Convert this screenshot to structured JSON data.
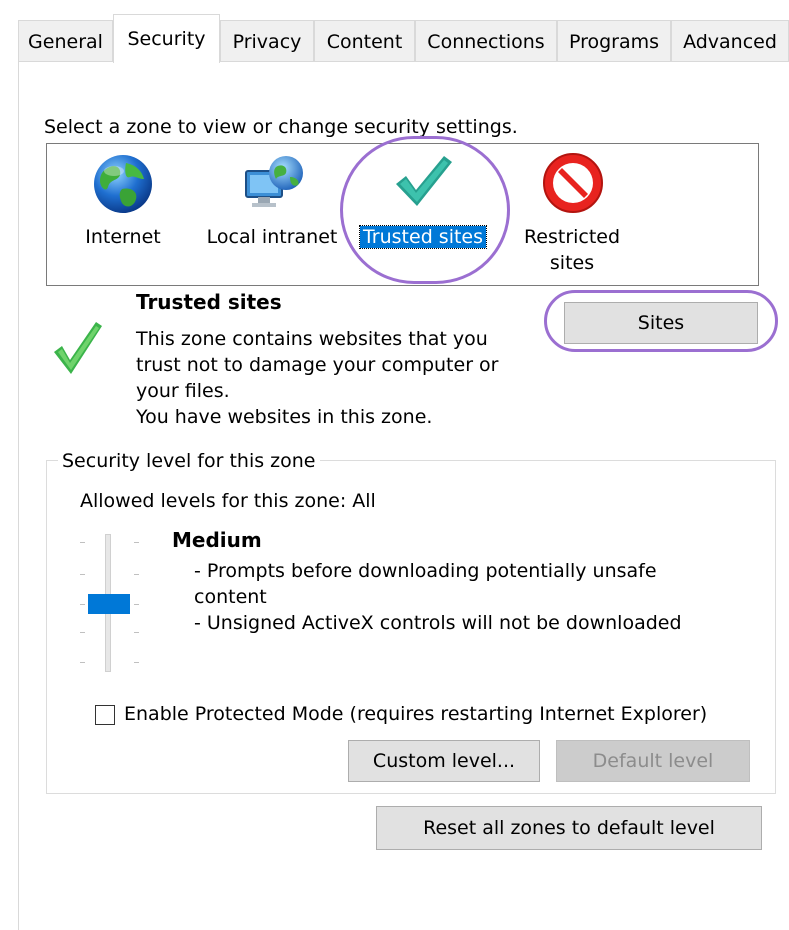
{
  "tabs": [
    {
      "label": "General",
      "active": false
    },
    {
      "label": "Security",
      "active": true
    },
    {
      "label": "Privacy",
      "active": false
    },
    {
      "label": "Content",
      "active": false
    },
    {
      "label": "Connections",
      "active": false
    },
    {
      "label": "Programs",
      "active": false
    },
    {
      "label": "Advanced",
      "active": false
    }
  ],
  "zone_prompt": "Select a zone to view or change security settings.",
  "zones": [
    {
      "label": "Internet",
      "icon": "globe-icon"
    },
    {
      "label": "Local intranet",
      "icon": "intranet-icon"
    },
    {
      "label": "Trusted sites",
      "icon": "green-checkmark-icon",
      "selected": true
    },
    {
      "label_line1": "Restricted",
      "label_line2": "sites",
      "icon": "restricted-icon"
    }
  ],
  "selected_zone": {
    "title": "Trusted sites",
    "description": [
      "This zone contains websites that you",
      "trust not to damage your computer or",
      "your files.",
      "You have websites in this zone."
    ],
    "sites_button": "Sites"
  },
  "security_level": {
    "group_label": "Security level for this zone",
    "allowed_levels": "Allowed levels for this zone: All",
    "level_name": "Medium",
    "details": [
      "- Prompts before downloading potentially unsafe",
      "content",
      "- Unsigned ActiveX controls will not be downloaded"
    ],
    "slider_position": "Medium"
  },
  "protected_mode": {
    "label": "Enable Protected Mode (requires restarting Internet Explorer)",
    "checked": false
  },
  "buttons": {
    "custom_level": "Custom level...",
    "default_level": "Default level",
    "reset_all": "Reset all zones to default level"
  },
  "colors": {
    "selection": "#0078d7",
    "annotation": "#9b6fd1",
    "check_green": "#3fbf3f",
    "slider_thumb": "#0078d7"
  }
}
